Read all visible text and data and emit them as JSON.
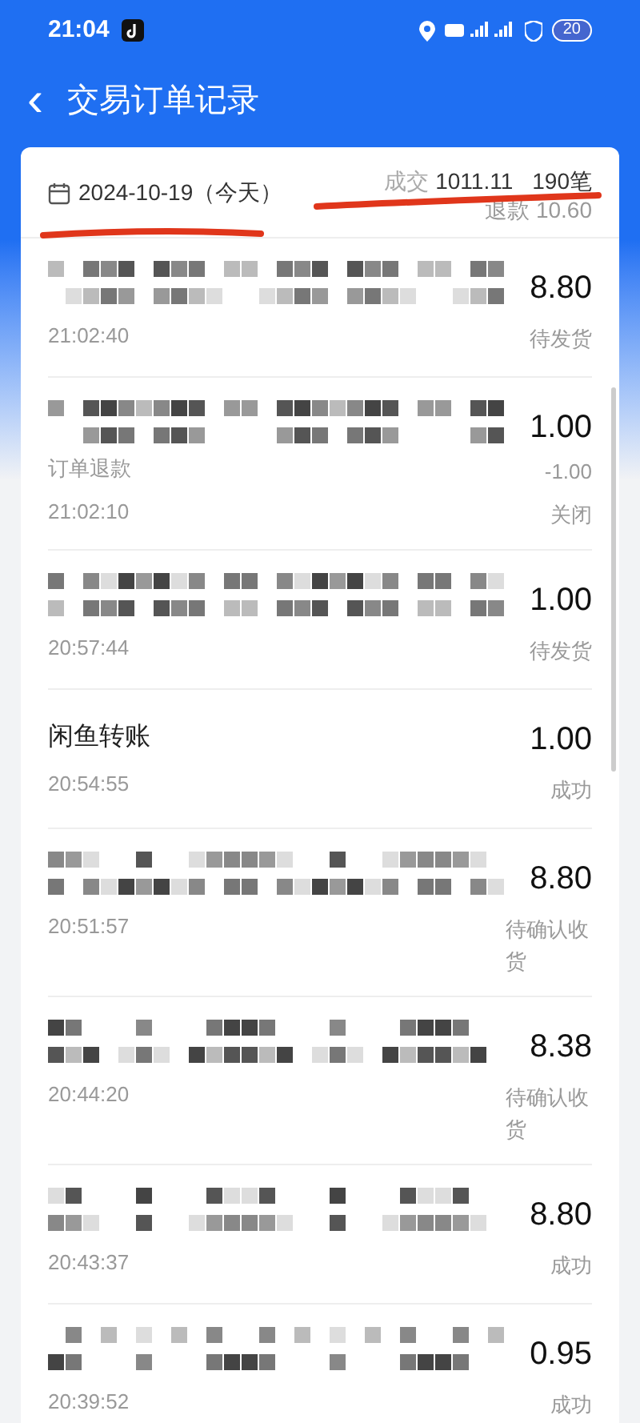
{
  "status_bar": {
    "time": "21:04",
    "battery": "20"
  },
  "header": {
    "back": "‹",
    "title": "交易订单记录"
  },
  "summary": {
    "date": "2024-10-19（今天）",
    "deal_label": "成交",
    "deal_amount": "1011.11",
    "count": "190笔",
    "refund_label": "退款",
    "refund_amount": "10.60"
  },
  "orders": [
    {
      "kind": "redacted",
      "amount": "8.80",
      "time": "21:02:40",
      "status": "待发货"
    },
    {
      "kind": "redacted",
      "amount": "1.00",
      "note": "订单退款",
      "refund": "-1.00",
      "time": "21:02:10",
      "status": "关闭"
    },
    {
      "kind": "redacted",
      "amount": "1.00",
      "time": "20:57:44",
      "status": "待发货"
    },
    {
      "kind": "plain",
      "title": "闲鱼转账",
      "amount": "1.00",
      "time": "20:54:55",
      "status": "成功"
    },
    {
      "kind": "redacted",
      "amount": "8.80",
      "time": "20:51:57",
      "status": "待确认收货"
    },
    {
      "kind": "redacted",
      "amount": "8.38",
      "time": "20:44:20",
      "status": "待确认收货"
    },
    {
      "kind": "redacted",
      "amount": "8.80",
      "time": "20:43:37",
      "status": "成功"
    },
    {
      "kind": "redacted",
      "amount": "0.95",
      "time": "20:39:52",
      "status": "成功"
    }
  ]
}
